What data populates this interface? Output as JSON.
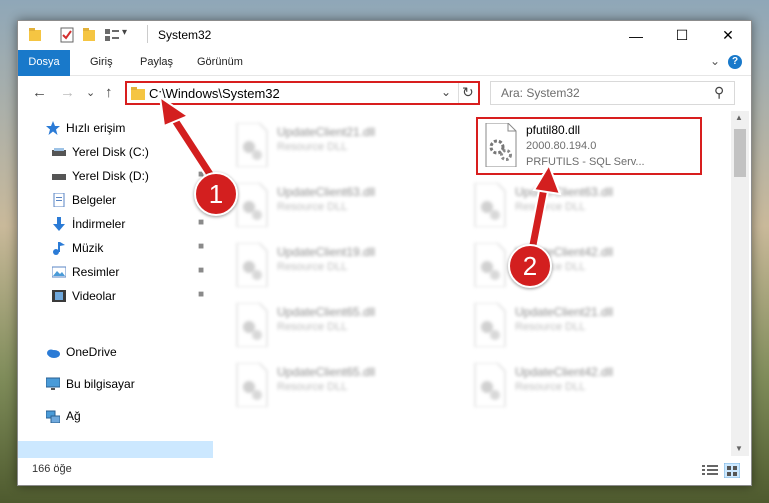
{
  "window": {
    "title": "System32",
    "controls": {
      "minimize": "—",
      "maximize": "☐",
      "close": "✕"
    }
  },
  "ribbon": {
    "tabs": [
      "Dosya",
      "Giriş",
      "Paylaş",
      "Görünüm"
    ],
    "collapse_icon": "⌄",
    "help_icon": "?"
  },
  "nav": {
    "back": "←",
    "forward": "→",
    "recent": "⌄",
    "up": "↑",
    "address": "C:\\Windows\\System32",
    "dropdown": "⌄",
    "refresh": "↻",
    "search_placeholder": "Ara: System32",
    "search_icon": "⚲"
  },
  "sidebar": {
    "items": [
      {
        "label": "Hızlı erişim",
        "icon": "star-icon",
        "pinned": false
      },
      {
        "label": "Yerel Disk (C:)",
        "icon": "drive-icon",
        "pinned": true
      },
      {
        "label": "Yerel Disk (D:)",
        "icon": "drive-icon",
        "pinned": true
      },
      {
        "label": "Belgeler",
        "icon": "documents-icon",
        "pinned": true
      },
      {
        "label": "İndirmeler",
        "icon": "download-icon",
        "pinned": true
      },
      {
        "label": "Müzik",
        "icon": "music-icon",
        "pinned": true
      },
      {
        "label": "Resimler",
        "icon": "pictures-icon",
        "pinned": true
      },
      {
        "label": "Videolar",
        "icon": "videos-icon",
        "pinned": true
      },
      {
        "label": "OneDrive",
        "icon": "cloud-icon",
        "pinned": false
      },
      {
        "label": "Bu bilgisayar",
        "icon": "computer-icon",
        "pinned": false,
        "selected": true
      },
      {
        "label": "Ağ",
        "icon": "network-icon",
        "pinned": false
      }
    ],
    "pin_glyph": "📌"
  },
  "files": {
    "left_column": [
      {
        "name": "UpdateClient21.dll",
        "type": "Resource DLL"
      },
      {
        "name": "UpdateClient63.dll",
        "type": "Resource DLL"
      },
      {
        "name": "UpdateClient19.dll",
        "type": "Resource DLL"
      },
      {
        "name": "UpdateClient65.dll",
        "type": "Resource DLL"
      },
      {
        "name": "UpdateClient65.dll",
        "type": "Resource DLL"
      }
    ],
    "right_column": [
      {
        "name": "UpdateClient63.dll",
        "type": "Resource DLL"
      },
      {
        "name": "UpdateClient42.dll",
        "type": "Resource DLL"
      },
      {
        "name": "UpdateClient21.dll",
        "type": "Resource DLL"
      },
      {
        "name": "UpdateClient42.dll",
        "type": "Resource DLL"
      }
    ],
    "highlighted": {
      "name": "pfutil80.dll",
      "version": "2000.80.194.0",
      "description": "PRFUTILS - SQL Serv..."
    }
  },
  "status": {
    "count": "166 öğe"
  },
  "markers": {
    "one": "1",
    "two": "2"
  },
  "colors": {
    "accent": "#1979ca",
    "highlight": "#d81e1e",
    "selection": "#cce8ff"
  }
}
